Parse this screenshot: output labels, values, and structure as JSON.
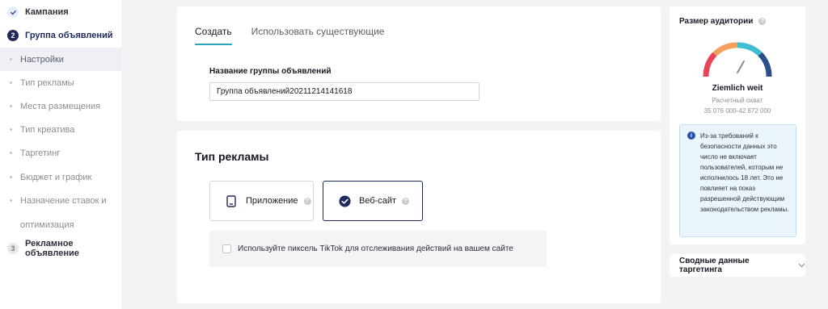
{
  "sidebar": {
    "steps": [
      {
        "number": "",
        "label": "Кампания"
      },
      {
        "number": "2",
        "label": "Группа объявлений"
      },
      {
        "number": "3",
        "label": "Рекламное объявление"
      }
    ],
    "substeps": [
      "Настройки",
      "Тип рекламы",
      "Места размещения",
      "Тип креатива",
      "Таргетинг",
      "Бюджет и график",
      "Назначение ставок и",
      "оптимизация"
    ]
  },
  "ad_group": {
    "tabs": [
      "Создать",
      "Использовать существующие"
    ],
    "name_label": "Название группы объявлений",
    "name_value": "Группа объявлений20211214141618"
  },
  "ad_type": {
    "title": "Тип рекламы",
    "options": [
      "Приложение",
      "Веб-сайт"
    ],
    "selected": "Веб-сайт",
    "pixel_checkbox_label": "Используйте пиксель TikTok для отслеживания действий на вашем сайте"
  },
  "audience": {
    "title": "Размер аудитории",
    "status": "Ziemlich weit",
    "estimate_label": "Расчетный охват",
    "estimate_range": "35 076 000-42 872 000",
    "notice": "Из-за требований к безопасности данных это число не включает пользователей, которым не исполнилось 18 лет. Это не повлияет на показ разрешенной действующим законодательством рекламы."
  },
  "summary": {
    "label": "Сводные данные таргетинга"
  },
  "colors": {
    "accent": "#2aa6b8",
    "primary": "#1f2a5c",
    "gauge_left": "#e8455b",
    "gauge_mid": "#3dbfcf",
    "gauge_right": "#2b4f8a"
  },
  "icons": {
    "campaign_done": "check-icon",
    "app_option": "phone-icon",
    "website_option": "check-circle-icon",
    "help": "question-icon",
    "info": "info-icon",
    "summary_toggle": "chevron-down-icon"
  }
}
